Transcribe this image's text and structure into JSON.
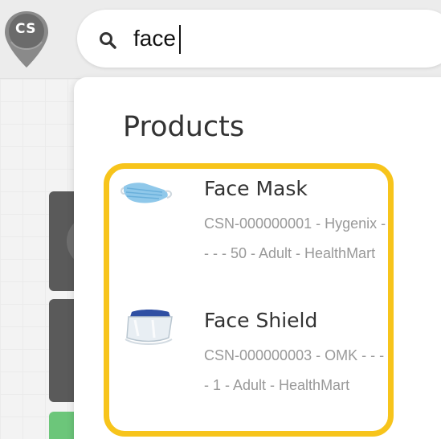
{
  "app": {
    "logo_text": "CS"
  },
  "search": {
    "value": "face",
    "icon": "search-icon"
  },
  "dropdown": {
    "section_title": "Products",
    "highlight_color": "#f7c41b",
    "products": [
      {
        "name": "Face Mask",
        "description": "CSN-000000001 - Hygenix - - - - 50 - Adult - HealthMart",
        "thumbnail": "face-mask-icon"
      },
      {
        "name": "Face Shield",
        "description": "CSN-000000003 - OMK - - - - 1 - Adult - HealthMart",
        "thumbnail": "face-shield-icon"
      }
    ]
  },
  "colors": {
    "logo_pin": "#6b6b6b",
    "highlight": "#f7c41b",
    "text_primary": "#333333",
    "text_secondary": "#999999"
  }
}
